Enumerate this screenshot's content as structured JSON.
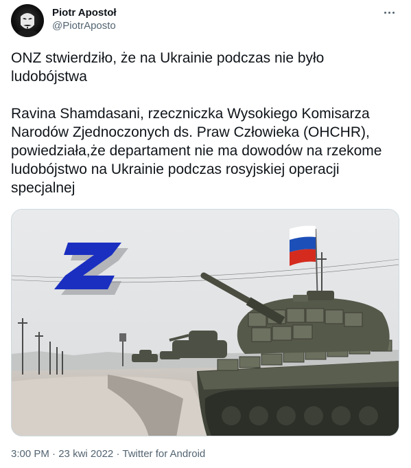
{
  "author": {
    "display_name": "Piotr Apostoł",
    "handle": "@PiotrAposto",
    "avatar_icon": "masked-face-avatar"
  },
  "more_icon": "more-horizontal-icon",
  "tweet": {
    "paragraph_1": "ONZ stwierdziło, że na Ukrainie podczas nie było ludobójstwa",
    "paragraph_2": "Ravina Shamdasani, rzeczniczka Wysokiego Komisarza Narodów Zjednoczonych ds. Praw Człowieka (OHCHR), powiedziała,że departament nie ma dowodów na rzekome ludobójstwo na Ukrainie podczas rosyjskiej operacji specjalnej"
  },
  "media": {
    "overlay_letter": "Z",
    "flag_colors": [
      "#ffffff",
      "#1c4fb8",
      "#d52b1e"
    ],
    "z_color": "#1a2fc0"
  },
  "meta": {
    "time": "3:00 PM",
    "separator": "·",
    "date": "23 kwi 2022",
    "source": "Twitter for Android"
  },
  "colors": {
    "text_primary": "#0f1419",
    "text_secondary": "#536471",
    "border": "#cfd9de"
  }
}
